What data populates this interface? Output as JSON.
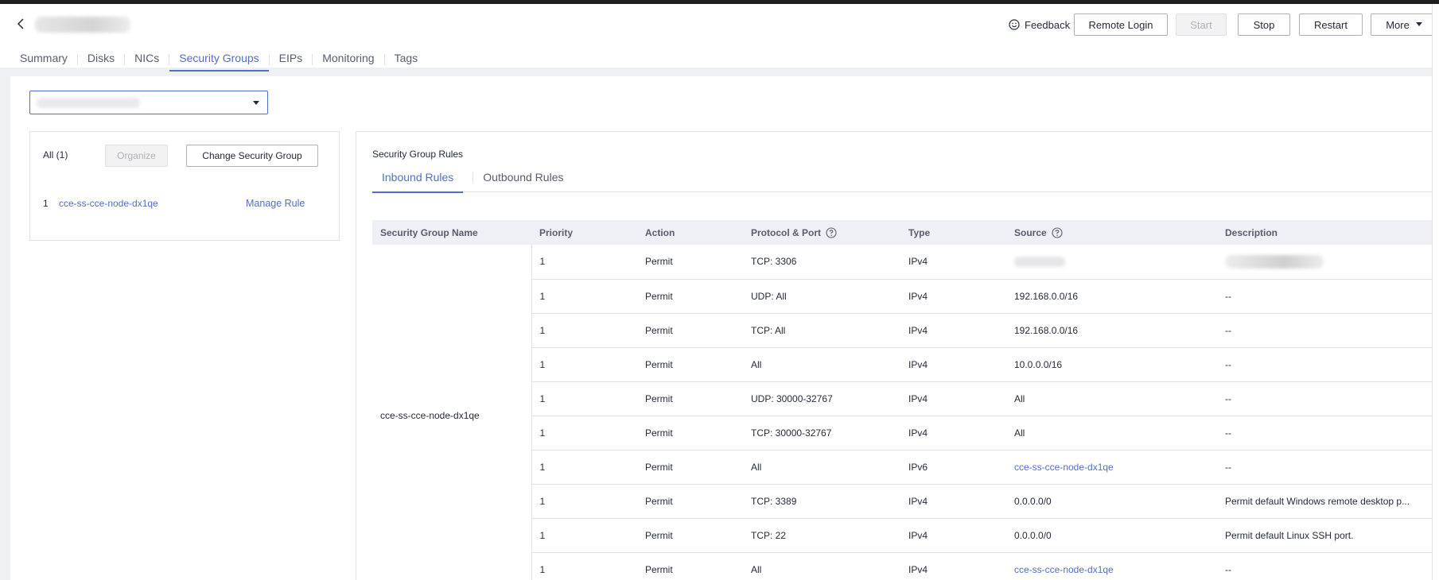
{
  "header": {
    "feedback": "Feedback",
    "remote_login": "Remote Login",
    "start": "Start",
    "stop": "Stop",
    "restart": "Restart",
    "more": "More"
  },
  "tabs": [
    {
      "label": "Summary",
      "active": false
    },
    {
      "label": "Disks",
      "active": false
    },
    {
      "label": "NICs",
      "active": false
    },
    {
      "label": "Security Groups",
      "active": true
    },
    {
      "label": "EIPs",
      "active": false
    },
    {
      "label": "Monitoring",
      "active": false
    },
    {
      "label": "Tags",
      "active": false
    }
  ],
  "left_panel": {
    "all_label": "All (1)",
    "organize": "Organize",
    "change_sg": "Change Security Group",
    "items": [
      {
        "index": "1",
        "name": "cce-ss-cce-node-dx1qe",
        "manage": "Manage Rule"
      }
    ]
  },
  "right_panel": {
    "title": "Security Group Rules",
    "subtabs": [
      {
        "label": "Inbound Rules",
        "active": true
      },
      {
        "label": "Outbound Rules",
        "active": false
      }
    ],
    "columns": [
      "Security Group Name",
      "Priority",
      "Action",
      "Protocol & Port",
      "Type",
      "Source",
      "Description"
    ],
    "sg_name": "cce-ss-cce-node-dx1qe",
    "rows": [
      {
        "priority": "1",
        "action": "Permit",
        "protocol_port": "TCP: 3306",
        "type": "IPv4",
        "source": "",
        "description": ""
      },
      {
        "priority": "1",
        "action": "Permit",
        "protocol_port": "UDP: All",
        "type": "IPv4",
        "source": "192.168.0.0/16",
        "description": "--"
      },
      {
        "priority": "1",
        "action": "Permit",
        "protocol_port": "TCP: All",
        "type": "IPv4",
        "source": "192.168.0.0/16",
        "description": "--"
      },
      {
        "priority": "1",
        "action": "Permit",
        "protocol_port": "All",
        "type": "IPv4",
        "source": "10.0.0.0/16",
        "description": "--"
      },
      {
        "priority": "1",
        "action": "Permit",
        "protocol_port": "UDP: 30000-32767",
        "type": "IPv4",
        "source": "All",
        "description": "--"
      },
      {
        "priority": "1",
        "action": "Permit",
        "protocol_port": "TCP: 30000-32767",
        "type": "IPv4",
        "source": "All",
        "description": "--"
      },
      {
        "priority": "1",
        "action": "Permit",
        "protocol_port": "All",
        "type": "IPv6",
        "source": "cce-ss-cce-node-dx1qe",
        "source_link": true,
        "description": "--"
      },
      {
        "priority": "1",
        "action": "Permit",
        "protocol_port": "TCP: 3389",
        "type": "IPv4",
        "source": "0.0.0.0/0",
        "description": "Permit default Windows remote desktop p..."
      },
      {
        "priority": "1",
        "action": "Permit",
        "protocol_port": "TCP: 22",
        "type": "IPv4",
        "source": "0.0.0.0/0",
        "description": "Permit default Linux SSH port."
      },
      {
        "priority": "1",
        "action": "Permit",
        "protocol_port": "All",
        "type": "IPv4",
        "source": "cce-ss-cce-node-dx1qe",
        "source_link": true,
        "description": "--"
      }
    ]
  },
  "colors": {
    "accent": "#526ecc",
    "border": "#dfe1e6",
    "table_header_bg": "#eef0f5",
    "page_bg": "#eff0f4"
  }
}
